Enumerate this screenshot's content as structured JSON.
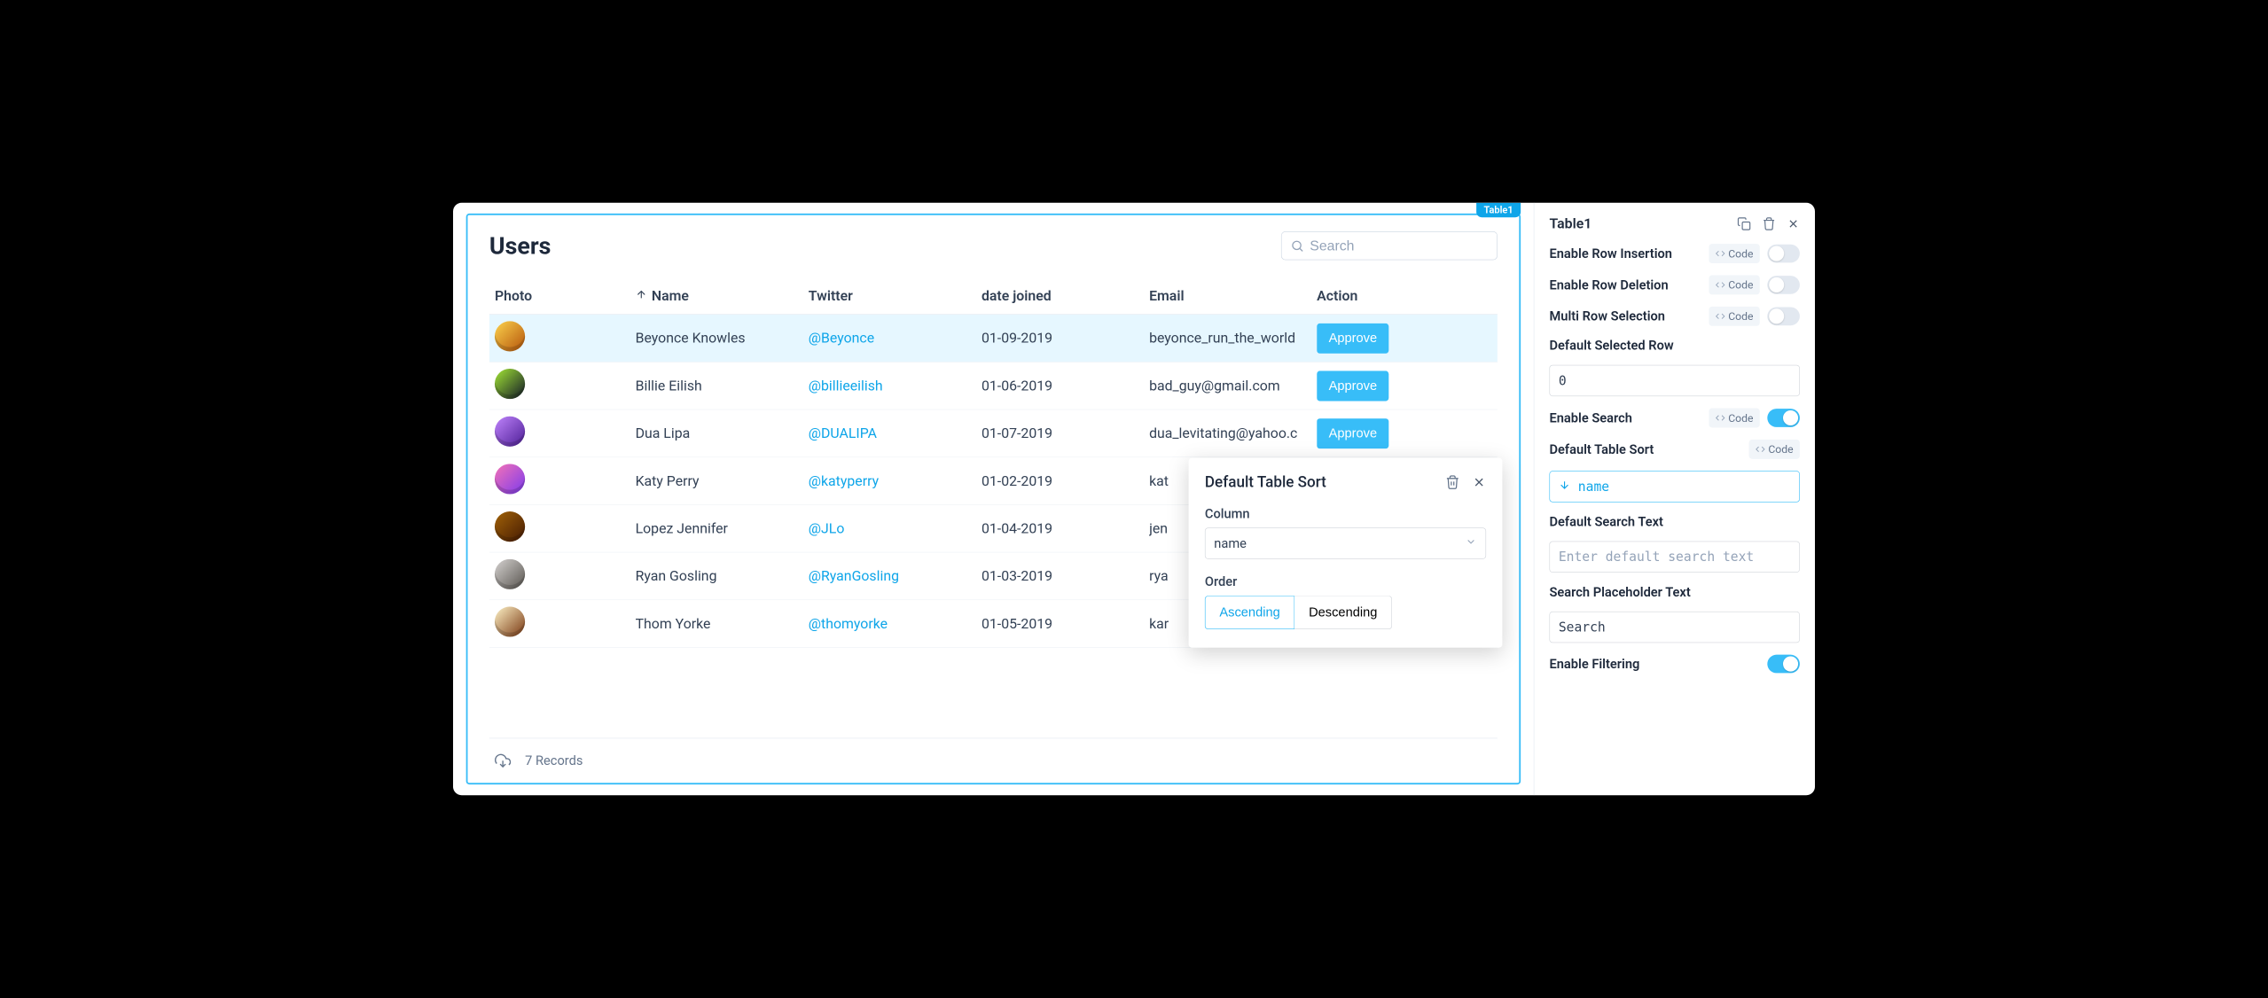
{
  "widget": {
    "tag": "Table1",
    "title": "Users",
    "search_placeholder": "Search",
    "columns": {
      "photo": "Photo",
      "name": "Name",
      "twitter": "Twitter",
      "date": "date joined",
      "email": "Email",
      "action": "Action"
    },
    "action_label": "Approve",
    "rows": [
      {
        "name": "Beyonce Knowles",
        "twitter": "@Beyonce",
        "date": "01-09-2019",
        "email": "beyonce_run_the_world"
      },
      {
        "name": "Billie Eilish",
        "twitter": "@billieeilish",
        "date": "01-06-2019",
        "email": "bad_guy@gmail.com"
      },
      {
        "name": "Dua Lipa",
        "twitter": "@DUALIPA",
        "date": "01-07-2019",
        "email": "dua_levitating@yahoo.c"
      },
      {
        "name": "Katy Perry",
        "twitter": "@katyperry",
        "date": "01-02-2019",
        "email": "kat"
      },
      {
        "name": "Lopez Jennifer",
        "twitter": "@JLo",
        "date": "01-04-2019",
        "email": "jen"
      },
      {
        "name": "Ryan Gosling",
        "twitter": "@RyanGosling",
        "date": "01-03-2019",
        "email": "rya"
      },
      {
        "name": "Thom Yorke",
        "twitter": "@thomyorke",
        "date": "01-05-2019",
        "email": "kar"
      }
    ],
    "footer": "7 Records"
  },
  "popup": {
    "title": "Default Table Sort",
    "column_label": "Column",
    "column_value": "name",
    "order_label": "Order",
    "order_asc": "Ascending",
    "order_desc": "Descending"
  },
  "panel": {
    "title": "Table1",
    "code_chip": "Code",
    "props": {
      "row_insertion": "Enable Row Insertion",
      "row_deletion": "Enable Row Deletion",
      "multi_row": "Multi Row Selection",
      "default_selected": "Default Selected Row",
      "default_selected_value": "0",
      "enable_search": "Enable Search",
      "default_sort": "Default Table Sort",
      "default_sort_value": "name",
      "default_search_text": "Default Search Text",
      "default_search_placeholder": "Enter default search text",
      "search_placeholder_label": "Search Placeholder Text",
      "search_placeholder_value": "Search",
      "enable_filtering": "Enable Filtering"
    }
  },
  "avatar_colors": [
    "linear-gradient(135deg,#fcd34d,#b45309)",
    "linear-gradient(135deg,#a3e635,#111827)",
    "linear-gradient(135deg,#c084fc,#4c1d95)",
    "linear-gradient(135deg,#f472b6,#7c3aed)",
    "linear-gradient(135deg,#a16207,#451a03)",
    "linear-gradient(135deg,#d6d3d1,#57534e)",
    "linear-gradient(135deg,#fef3c7,#78350f)"
  ]
}
